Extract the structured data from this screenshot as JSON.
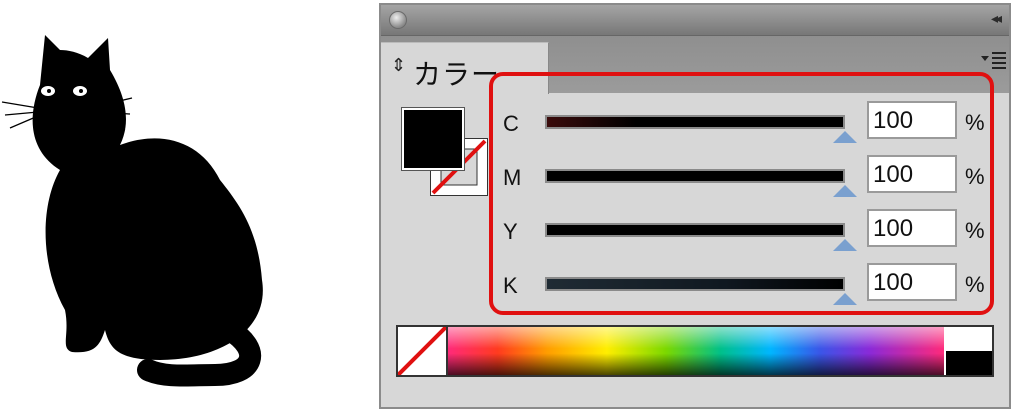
{
  "panel": {
    "tab_arrows": "⇕",
    "tab_title": "カラー",
    "collapse_icon": "◂◂"
  },
  "rows": [
    {
      "label": "C",
      "value": "100",
      "unit": "%",
      "gradient_from": "#3a0b0b",
      "gradient_to": "#000000"
    },
    {
      "label": "M",
      "value": "100",
      "unit": "%",
      "gradient_from": "#000000",
      "gradient_to": "#000000"
    },
    {
      "label": "Y",
      "value": "100",
      "unit": "%",
      "gradient_from": "#000000",
      "gradient_to": "#000000"
    },
    {
      "label": "K",
      "value": "100",
      "unit": "%",
      "gradient_from": "#1f2b34",
      "gradient_to": "#000000"
    }
  ],
  "colors": {
    "highlight": "#e01010",
    "thumb": "#7aa0cf",
    "panel_bg": "#d7d7d7"
  }
}
